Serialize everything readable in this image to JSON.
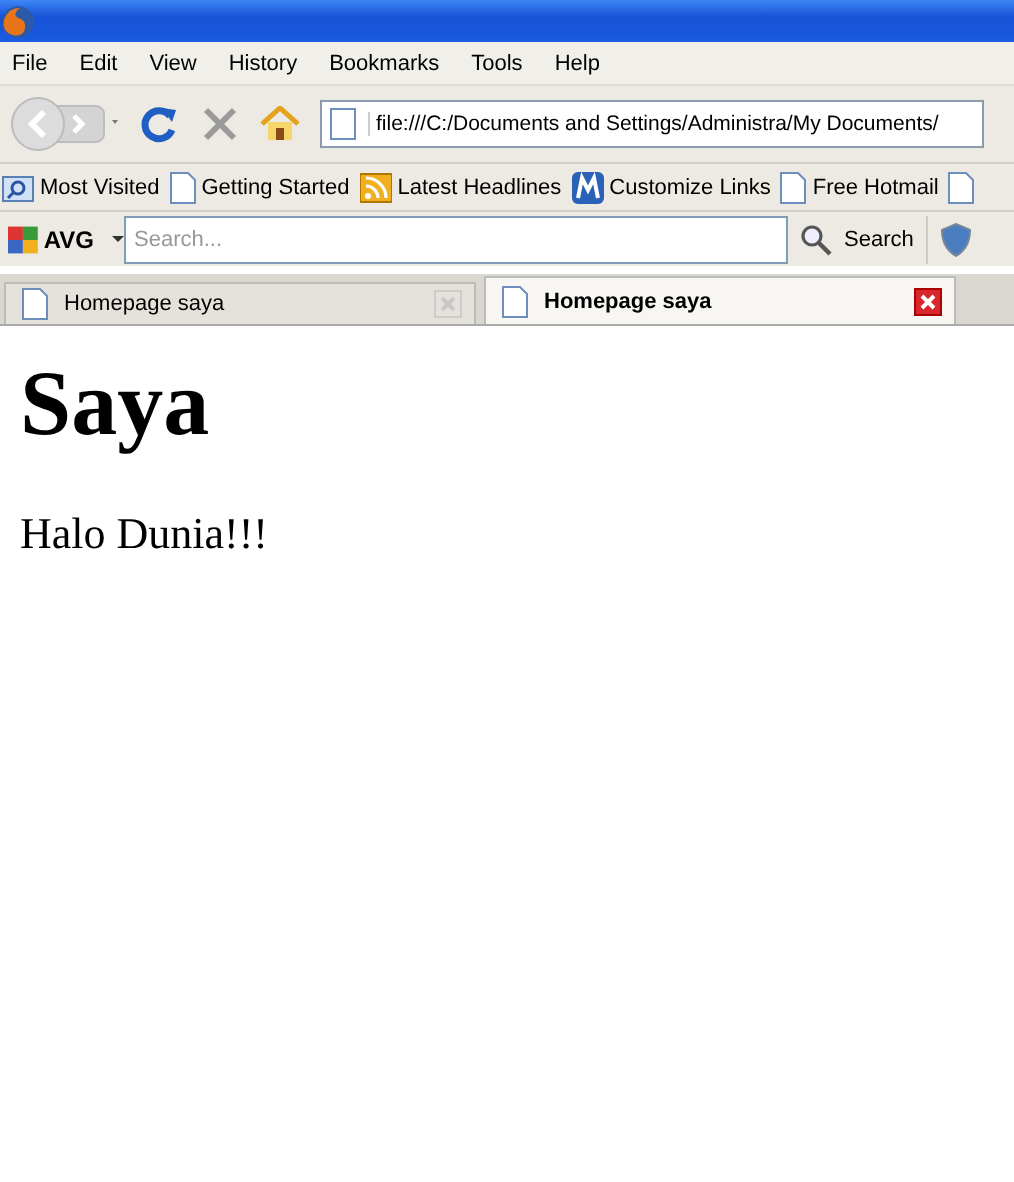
{
  "menu": [
    "File",
    "Edit",
    "View",
    "History",
    "Bookmarks",
    "Tools",
    "Help"
  ],
  "address": {
    "value": "file:///C:/Documents and Settings/Administra/My Documents/"
  },
  "bookmarks": [
    {
      "kind": "folder",
      "label": "Most Visited"
    },
    {
      "kind": "page",
      "label": "Getting Started"
    },
    {
      "kind": "feed",
      "label": "Latest Headlines"
    },
    {
      "kind": "m",
      "label": "Customize Links"
    },
    {
      "kind": "page",
      "label": "Free Hotmail"
    },
    {
      "kind": "page"
    }
  ],
  "avg": {
    "logo": "AVG",
    "search": {
      "placeholder": "Search..."
    },
    "search_button": "Search"
  },
  "tabs": [
    {
      "label": "Homepage saya",
      "selected": false
    },
    {
      "label": "Homepage saya",
      "selected": true
    }
  ],
  "page": {
    "heading": "Saya",
    "paragraph": "Halo Dunia!!!"
  }
}
